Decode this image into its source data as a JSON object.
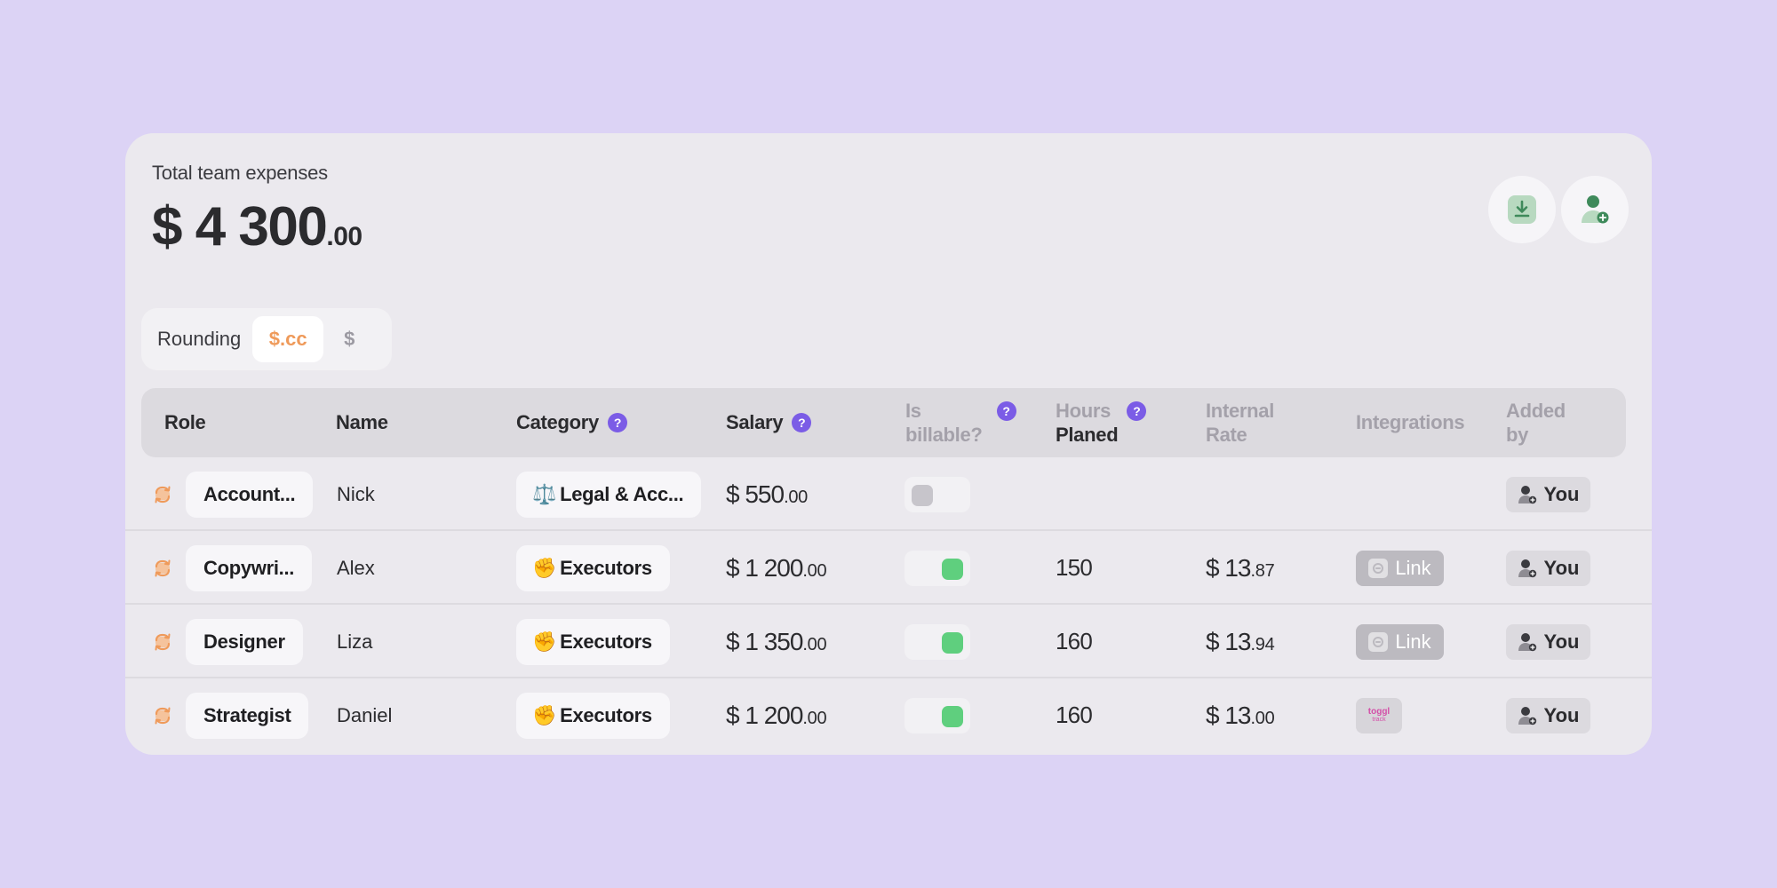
{
  "header": {
    "total_label": "Total team expenses",
    "total_main": "$ 4 300",
    "total_cents": ".00",
    "download_icon": "download-icon",
    "add_user_icon": "add-user-icon"
  },
  "rounding": {
    "label": "Rounding",
    "options": [
      "$.cc",
      "$"
    ],
    "selected": "$.cc"
  },
  "columns": {
    "role": "Role",
    "name": "Name",
    "category": "Category",
    "salary": "Salary",
    "billable_1": "Is",
    "billable_2": "billable?",
    "hours_1": "Hours",
    "hours_2": "Planed",
    "rate_1": "Internal",
    "rate_2": "Rate",
    "integrations": "Integrations",
    "added_1": "Added",
    "added_2": "by",
    "help": "?"
  },
  "rows": [
    {
      "role": "Account...",
      "name": "Nick",
      "category_emoji": "⚖️",
      "category": "Legal & Acc...",
      "salary_main": "$ 550",
      "salary_cents": ".00",
      "billable": false,
      "hours": "",
      "rate_main": "",
      "rate_cents": "",
      "integration": "",
      "added_by": "You"
    },
    {
      "role": "Copywri...",
      "name": "Alex",
      "category_emoji": "✊",
      "category": "Executors",
      "salary_main": "$ 1 200",
      "salary_cents": ".00",
      "billable": true,
      "hours": "150",
      "rate_main": "$ 13",
      "rate_cents": ".87",
      "integration": "Link",
      "added_by": "You"
    },
    {
      "role": "Designer",
      "name": "Liza",
      "category_emoji": "✊",
      "category": "Executors",
      "salary_main": "$ 1 350",
      "salary_cents": ".00",
      "billable": true,
      "hours": "160",
      "rate_main": "$ 13",
      "rate_cents": ".94",
      "integration": "Link",
      "added_by": "You"
    },
    {
      "role": "Strategist",
      "name": "Daniel",
      "category_emoji": "✊",
      "category": "Executors",
      "salary_main": "$ 1 200",
      "salary_cents": ".00",
      "billable": true,
      "hours": "160",
      "rate_main": "$ 13",
      "rate_cents": ".00",
      "integration": "toggl",
      "added_by": "You"
    }
  ],
  "toggl": {
    "t1": "toggl",
    "t2": "track"
  },
  "colors": {
    "accent_orange": "#ef9a5a",
    "help_purple": "#7b5ce6",
    "toggle_on": "#5fcf7e",
    "background": "#dcd3f5"
  }
}
